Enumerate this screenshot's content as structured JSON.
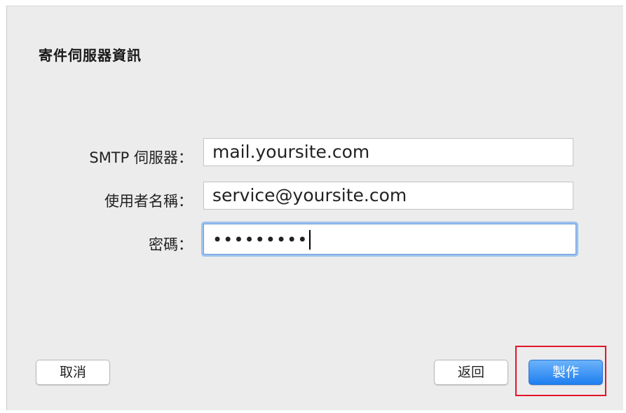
{
  "dialog": {
    "title": "寄件伺服器資訊"
  },
  "form": {
    "smtp_label": "SMTP 伺服器：",
    "smtp_value": "mail.yoursite.com",
    "user_label": "使用者名稱：",
    "user_value": "service@yoursite.com",
    "password_label": "密碼：",
    "password_mask": "•••••••••"
  },
  "buttons": {
    "cancel": "取消",
    "back": "返回",
    "create": "製作"
  },
  "colors": {
    "highlight_box": "#e3152a",
    "primary_button": "#1f7ff0",
    "focus_ring": "#9bc1ee"
  }
}
